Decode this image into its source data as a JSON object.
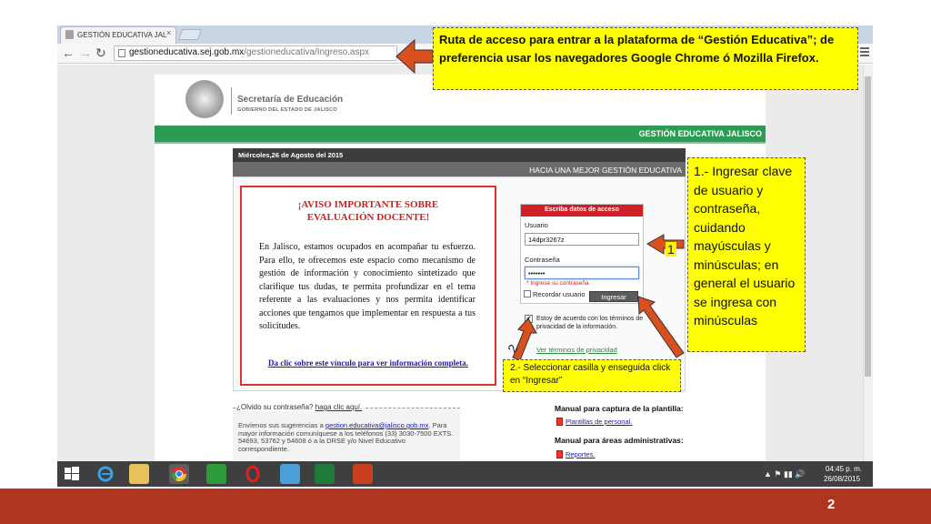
{
  "browser": {
    "tab_title": "GESTIÓN EDUCATIVA JAL",
    "tab_close": "×",
    "address_domain": "gestioneducativa.sej.gob.mx",
    "address_path": "/gestioneducativa/Ingreso.aspx",
    "back_icon": "←",
    "forward_icon": "→",
    "reload_icon": "↻"
  },
  "site": {
    "logo_title": "Secretaría de Educación",
    "logo_subtitle": "GOBIERNO DEL ESTADO DE JALISCO",
    "name": "GESTIÓN EDUCATIVA JALISCO",
    "date": "Miércoles,26 de Agosto del 2015",
    "slogan": "HACIA UNA MEJOR GESTIÓN EDUCATIVA"
  },
  "notice": {
    "title": "¡AVISO IMPORTANTE SOBRE EVALUACIÓN DOCENTE!",
    "body": "En Jalisco, estamos ocupados en acompañar tu esfuerzo. Para ello, te ofrecemos este espacio como mecanismo de gestión de información y conocimiento sintetizado que clarifique tus dudas, te permita profundizar en el tema referente a las evaluaciones y nos permita identificar acciones que tengamos que implementar en respuesta a tus solicitudes.",
    "link": "Da clic sobre este vínculo para ver información completa."
  },
  "login": {
    "header": "Escriba datos de acceso",
    "user_label": "Usuario",
    "user_value": "14dpr3267z",
    "password_label": "Contraseña",
    "password_value": "•••••••",
    "password_error": "* Ingrese su contraseña",
    "remember_label": "Recordar usuario",
    "submit_label": "Ingresar",
    "terms_check": "✔",
    "terms_label": "Estoy de acuerdo con los términos de privacidad de la información.",
    "terms_link": "Ver términos de privacidad"
  },
  "lower": {
    "forgot_prefix": "¿Olvido su contraseña?",
    "forgot_link": "haga clic aquí.",
    "suggest_prefix": "Envíenos sus sugerencias a",
    "suggest_email": "gestion.educativa@jalisco.gob.mx",
    "suggest_rest": ". Para mayor información comuníquese a los teléfonos (33) 3030-7500 EXTS. 54693, 53762 y 54608 ó a la DRSE y/o Nivel Educativo correspondiente.",
    "manual_title": "Manual para captura de la plantilla:",
    "manual_item": "Plantillas de personal.",
    "admin_title": "Manual para áreas administrativas:",
    "admin_item": "Reportes."
  },
  "taskbar": {
    "tray": "▲  ⚑  ▮▮  🔊",
    "time": "04:45 p. m.",
    "date": "26/08/2015",
    "icons": [
      "windows-start",
      "internet-explorer",
      "file-explorer",
      "chrome",
      "store",
      "opera",
      "network",
      "excel",
      "powerpoint"
    ]
  },
  "annotations": {
    "url_note": "Ruta de acceso para entrar a la plataforma de “Gestión Educativa”; de preferencia usar los navegadores Google Chrome ó Mozilla Firefox.",
    "login_note": "1.- Ingresar clave de usuario y contraseña, cuidando mayúsculas y minúsculas; en general el usuario se ingresa con minúsculas",
    "terms_note": "2.- Seleccionar casilla y enseguida click en “Ingresar”",
    "badge_1": "1",
    "badge_2": "2"
  },
  "slide": {
    "number": "2"
  },
  "colors": {
    "arrow": "#d9501f",
    "callout": "#ffff00",
    "slide_bar": "#b0351f",
    "site_green": "#2e9b55",
    "login_red": "#d01f26"
  }
}
